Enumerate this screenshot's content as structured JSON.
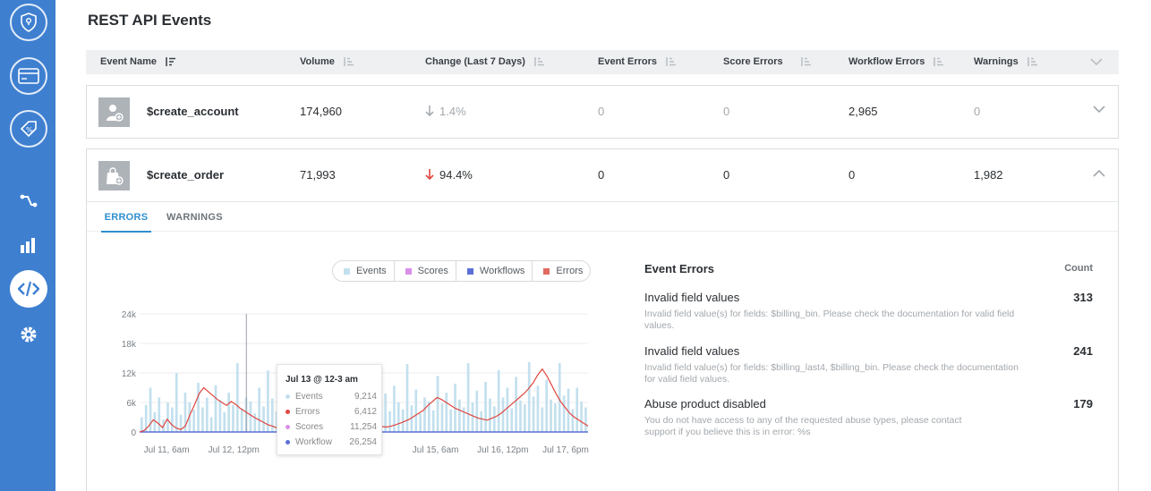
{
  "sidebar": {
    "items": [
      {
        "icon": "shield-icon",
        "active": false
      },
      {
        "icon": "card-icon",
        "active": false
      },
      {
        "icon": "tag-percent-icon",
        "active": false
      },
      {
        "icon": "workflow-icon",
        "active": false
      },
      {
        "icon": "bar-chart-icon",
        "active": false
      },
      {
        "icon": "code-icon",
        "active": true
      },
      {
        "icon": "gear-icon",
        "active": false
      }
    ],
    "accent": "#3e7fd0"
  },
  "page": {
    "title": "REST API Events"
  },
  "table": {
    "columns": [
      "Event Name",
      "Volume",
      "Change (Last 7 Days)",
      "Event Errors",
      "Score Errors",
      "Workflow Errors",
      "Warnings"
    ],
    "rows": [
      {
        "name": "$create_account",
        "volume": "174,960",
        "change": "1.4%",
        "event_errors": "0",
        "score_errors": "0",
        "workflow_errors": "2,965",
        "warnings": "0",
        "expanded": false
      },
      {
        "name": "$create_order",
        "volume": "71,993",
        "change": "94.4%",
        "event_errors": "0",
        "score_errors": "0",
        "workflow_errors": "0",
        "warnings": "1,982",
        "expanded": true
      }
    ]
  },
  "detail": {
    "tabs": [
      "ERRORS",
      "WARNINGS"
    ],
    "active_tab": "ERRORS",
    "legend": [
      {
        "label": "Events",
        "color": "#c3e0ee"
      },
      {
        "label": "Scores",
        "color": "#d98fe6"
      },
      {
        "label": "Workflows",
        "color": "#5b6fd6"
      },
      {
        "label": "Errors",
        "color": "#e06a5f"
      }
    ],
    "tooltip": {
      "title": "Jul 13 @ 12-3 am",
      "rows": [
        {
          "label": "Events",
          "value": "9,214",
          "color": "#c3e0ee"
        },
        {
          "label": "Errors",
          "value": "6,412",
          "color": "#e0463f"
        },
        {
          "label": "Scores",
          "value": "11,254",
          "color": "#d98fe6"
        },
        {
          "label": "Workflow",
          "value": "26,254",
          "color": "#5b6fd6"
        }
      ]
    },
    "errors_panel": {
      "title": "Event Errors",
      "count_header": "Count",
      "items": [
        {
          "name": "Invalid field values",
          "desc": "Invalid field value(s) for fields: $billing_bin. Please check the documentation for valid field values.",
          "count": "313"
        },
        {
          "name": "Invalid field values",
          "desc": "Invalid field value(s) for fields: $billing_last4, $billing_bin. Please check the documentation for valid field values.",
          "count": "241"
        },
        {
          "name": "Abuse product disabled",
          "desc": "You do not have access to any of the requested abuse types, please contact support if you believe this is in error: %s",
          "count": "179"
        }
      ]
    }
  },
  "chart_data": {
    "type": "bar",
    "yticks": [
      "24k",
      "18k",
      "12k",
      "6k",
      "0"
    ],
    "ylim": [
      0,
      24000
    ],
    "xticks": [
      "Jul 11, 6am",
      "Jul 12, 12pm",
      "Jul 15, 6am",
      "Jul 16, 12pm",
      "Jul 17, 6pm"
    ],
    "series": [
      {
        "name": "Events",
        "type": "bar",
        "values": [
          3000,
          5500,
          9000,
          4000,
          7000,
          2500,
          6000,
          5000,
          12000,
          3500,
          8000,
          6000,
          4500,
          10000,
          5000,
          7000,
          3000,
          9500,
          6500,
          4000,
          8000,
          5500,
          14000,
          4800,
          7000,
          6200,
          3800,
          9000,
          5200,
          12500,
          6800,
          4200,
          9200,
          5000,
          7600,
          3900,
          11000,
          6000,
          5400,
          8800,
          4600,
          7200,
          5800,
          3400,
          9600,
          6600,
          4400,
          10800,
          5200,
          7400,
          3600,
          8200,
          6400,
          4800,
          12200,
          5600,
          7800,
          4200,
          9400,
          6000,
          4600,
          13800,
          5400,
          8600,
          3800,
          7000,
          6200,
          4400,
          11400,
          5800,
          8000,
          4600,
          9800,
          6600,
          5000,
          14000,
          6000,
          8400,
          4200,
          10200,
          6800,
          5200,
          12600,
          7000,
          9000,
          4800,
          11200,
          6400,
          5600,
          14200,
          7200,
          9400,
          5000,
          10600,
          6600,
          5800,
          14000,
          7400,
          8800,
          4600,
          9000,
          6200,
          5000
        ]
      },
      {
        "name": "Errors",
        "type": "line",
        "values": [
          0,
          300,
          1200,
          2500,
          1800,
          900,
          2600,
          1500,
          800,
          500,
          1200,
          3500,
          5500,
          7800,
          9000,
          8200,
          7400,
          6600,
          6000,
          5400,
          6200,
          5600,
          4800,
          4200,
          3600,
          3000,
          2500,
          2000,
          1500,
          1200,
          800,
          600,
          400,
          300,
          200,
          100,
          200,
          500,
          1000,
          2000,
          2800,
          3400,
          3800,
          4000,
          3600,
          3200,
          2800,
          2400,
          2000,
          1700,
          1500,
          1300,
          1200,
          1100,
          1000,
          1200,
          1500,
          1800,
          2200,
          2600,
          3200,
          3800,
          4400,
          5400,
          6200,
          7000,
          6600,
          6000,
          5400,
          4800,
          4400,
          4000,
          3600,
          3200,
          2800,
          2600,
          2400,
          2800,
          3200,
          3800,
          4600,
          5400,
          6200,
          7000,
          7800,
          8800,
          10000,
          11600,
          12800,
          11400,
          9600,
          7800,
          6200,
          5000,
          3800,
          3000,
          2400,
          1800,
          1200
        ]
      },
      {
        "name": "Workflows",
        "type": "bar",
        "values": [
          0
        ]
      }
    ]
  }
}
